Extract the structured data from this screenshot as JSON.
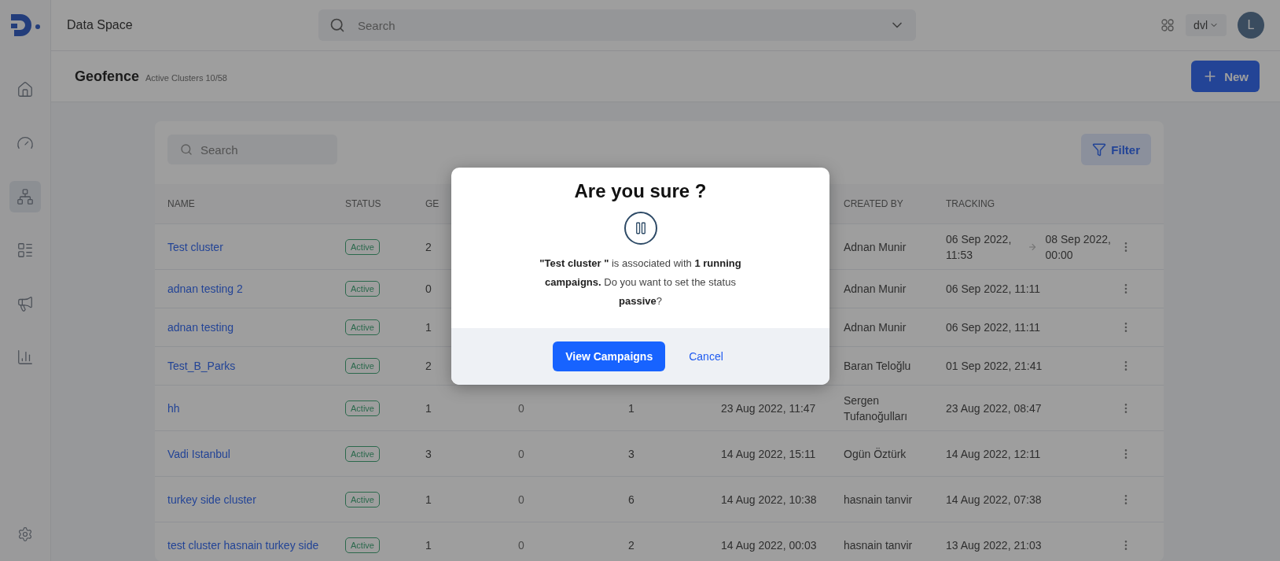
{
  "app": {
    "name": "Data Space"
  },
  "top_search": {
    "placeholder": "Search"
  },
  "workspace": {
    "label": "dvl"
  },
  "avatar": {
    "initial": "L"
  },
  "sidebar": {
    "items": [
      {
        "kind": "home",
        "selected": false
      },
      {
        "kind": "gauge",
        "selected": false
      },
      {
        "kind": "network",
        "selected": true
      },
      {
        "kind": "list",
        "selected": false
      },
      {
        "kind": "megaphone",
        "selected": false
      },
      {
        "kind": "chart",
        "selected": false
      }
    ],
    "bottom": {
      "kind": "settings"
    }
  },
  "page": {
    "title": "Geofence",
    "subtitle": "Active Clusters 10/58",
    "new_button": "New"
  },
  "table": {
    "search": {
      "placeholder": "Search"
    },
    "filter_button": "Filter",
    "columns": [
      "NAME",
      "STATUS",
      "GE",
      "CREATED BY",
      "TRACKING"
    ],
    "rows": [
      {
        "name": "Test cluster",
        "status": "Active",
        "geo": "2",
        "created_by": "Adnan Munir",
        "tracking": [
          "06 Sep 2022, 11:53",
          "08 Sep 2022, 00:00"
        ]
      },
      {
        "name": "adnan testing 2",
        "status": "Active",
        "geo": "0",
        "created_by": "Adnan Munir",
        "tracking": [
          "06 Sep 2022, 11:11"
        ]
      },
      {
        "name": "adnan testing",
        "status": "Active",
        "geo": "1",
        "created_by": "Adnan Munir",
        "tracking": [
          "06 Sep 2022, 11:11"
        ]
      },
      {
        "name": "Test_B_Parks",
        "status": "Active",
        "geo": "2",
        "created_by": "Baran Teloğlu",
        "tracking": [
          "01 Sep 2022, 21:41"
        ]
      },
      {
        "name": "hh",
        "status": "Active",
        "geo": "1",
        "column_4": "0",
        "column_5": "1",
        "created": "23 Aug 2022, 11:47",
        "created_by": "Sergen Tufanoğulları",
        "tracking": [
          "23 Aug 2022, 08:47"
        ]
      },
      {
        "name": "Vadi Istanbul",
        "status": "Active",
        "geo": "3",
        "column_4": "0",
        "column_5": "3",
        "created": "14 Aug 2022, 15:11",
        "created_by": "Ogün Öztürk",
        "tracking": [
          "14 Aug 2022, 12:11"
        ]
      },
      {
        "name": "turkey side cluster",
        "status": "Active",
        "geo": "1",
        "column_4": "0",
        "column_5": "6",
        "created": "14 Aug 2022, 10:38",
        "created_by": "hasnain tanvir",
        "tracking": [
          "14 Aug 2022, 07:38"
        ]
      },
      {
        "name": "test cluster hasnain turkey side",
        "status": "Active",
        "geo": "1",
        "column_4": "0",
        "column_5": "2",
        "created": "14 Aug 2022, 00:03",
        "created_by": "hasnain tanvir",
        "tracking": [
          "13 Aug 2022, 21:03"
        ]
      }
    ]
  },
  "dialog": {
    "title": "Are you sure ?",
    "message": "**\"Test cluster \"** is associated with **1 running campaigns.** Do you want to set the status **passive**?",
    "primary": "View Campaigns",
    "secondary": "Cancel"
  }
}
